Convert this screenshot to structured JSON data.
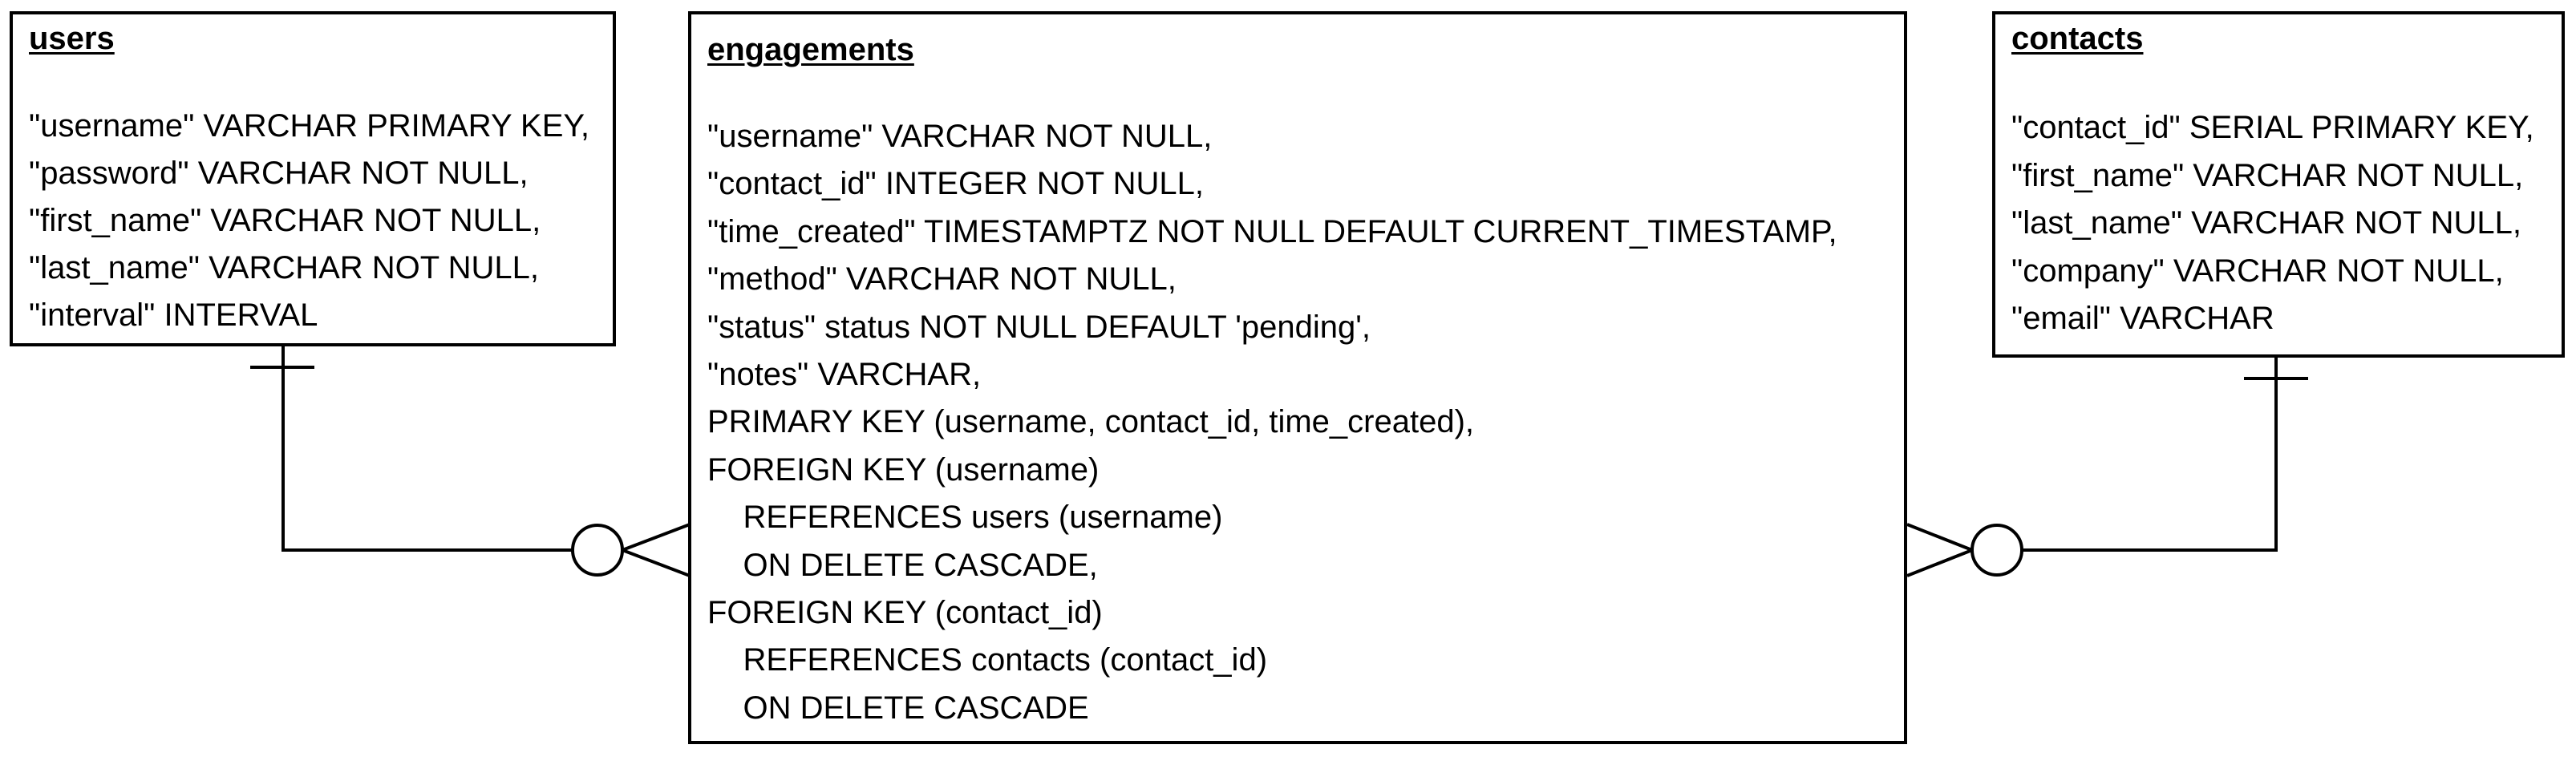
{
  "diagram": {
    "entities": [
      {
        "name": "users",
        "columns": [
          "\"username\" VARCHAR PRIMARY KEY,",
          "\"password\" VARCHAR NOT NULL,",
          "\"first_name\" VARCHAR NOT NULL,",
          "\"last_name\" VARCHAR NOT NULL,",
          "\"interval\" INTERVAL"
        ]
      },
      {
        "name": "engagements",
        "columns": [
          "\"username\" VARCHAR NOT NULL,",
          "\"contact_id\" INTEGER NOT NULL,",
          "\"time_created\" TIMESTAMPTZ NOT NULL DEFAULT CURRENT_TIMESTAMP,",
          "\"method\" VARCHAR NOT NULL,",
          "\"status\" status NOT NULL DEFAULT 'pending',",
          "\"notes\" VARCHAR,",
          "PRIMARY KEY (username, contact_id, time_created),",
          "FOREIGN KEY (username)",
          "    REFERENCES users (username)",
          "    ON DELETE CASCADE,",
          "FOREIGN KEY (contact_id)",
          "    REFERENCES contacts (contact_id)",
          "    ON DELETE CASCADE"
        ]
      },
      {
        "name": "contacts",
        "columns": [
          "\"contact_id\" SERIAL PRIMARY KEY,",
          "\"first_name\" VARCHAR NOT NULL,",
          "\"last_name\" VARCHAR NOT NULL,",
          "\"company\" VARCHAR NOT NULL,",
          "\"email\" VARCHAR"
        ]
      }
    ],
    "relationships": [
      {
        "from": "users",
        "to": "engagements",
        "from_cardinality": "exactly-one",
        "to_cardinality": "zero-or-many"
      },
      {
        "from": "contacts",
        "to": "engagements",
        "from_cardinality": "exactly-one",
        "to_cardinality": "zero-or-many"
      }
    ],
    "line_color": "#000000",
    "background_color": "#ffffff"
  }
}
